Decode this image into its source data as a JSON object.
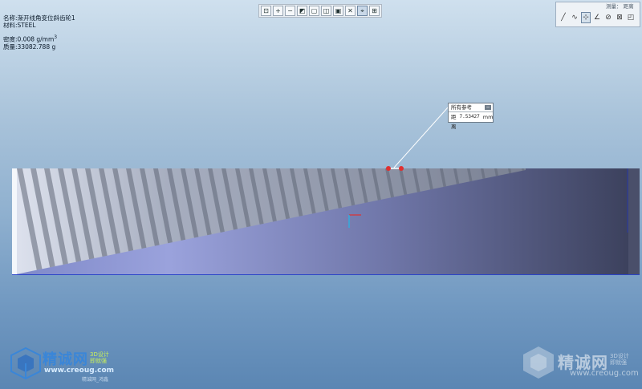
{
  "model_info": {
    "name": "名称:渐开线角变位斜齿轮1",
    "material": "材料:STEEL",
    "density": "密度:0.008 g/mm",
    "density_exponent": "3",
    "mass": "质量:33082.788 g"
  },
  "toolbar": {
    "buttons": [
      {
        "name": "zoom-fit-icon",
        "glyph": "⊡"
      },
      {
        "name": "zoom-in-icon",
        "glyph": "+"
      },
      {
        "name": "zoom-out-icon",
        "glyph": "−"
      },
      {
        "name": "repaint-icon",
        "glyph": "◩"
      },
      {
        "name": "view-orient-icon",
        "glyph": "▢"
      },
      {
        "name": "saved-views-icon",
        "glyph": "◫"
      },
      {
        "name": "display-style-icon",
        "glyph": "▣"
      },
      {
        "name": "datum-display-icon",
        "glyph": "✕"
      },
      {
        "name": "measure-icon",
        "glyph": "⌖",
        "active": true
      },
      {
        "name": "annotation-icon",
        "glyph": "⊞"
      }
    ]
  },
  "right_panel": {
    "header": "测量：  距离",
    "tools": [
      {
        "name": "length-icon",
        "glyph": "╱"
      },
      {
        "name": "curve-icon",
        "glyph": "∿"
      },
      {
        "name": "distance-icon",
        "glyph": "⊹",
        "active": true
      },
      {
        "name": "angle-icon",
        "glyph": "∠"
      },
      {
        "name": "diameter-icon",
        "glyph": "⊘"
      },
      {
        "name": "transform-icon",
        "glyph": "⊠"
      },
      {
        "name": "area-icon",
        "glyph": "◰"
      }
    ]
  },
  "callout": {
    "title": "所有参考",
    "minimize": "−",
    "label": "距离",
    "value": "7.53427",
    "unit": "mm"
  },
  "watermark_left": {
    "name": "精诚网",
    "tag_line1": "3D设计",
    "tag_line2": "即就强",
    "url": "www.creoug.com",
    "sub": "精诚网_鸿鑫"
  },
  "watermark_right": {
    "name": "精诚网",
    "tag_line1": "3D设计",
    "tag_line2": "即就强",
    "url": "www.creoug.com"
  },
  "colors": {
    "background_top": "#cfe0ee",
    "background_bottom": "#5b86b3",
    "model_light": "#9aa2dc",
    "model_dark": "#3a3f5a",
    "teeth": "#8e97a8",
    "measure_point": "#e03030",
    "axis_x": "#e03030",
    "axis_y": "#22b8e8"
  }
}
